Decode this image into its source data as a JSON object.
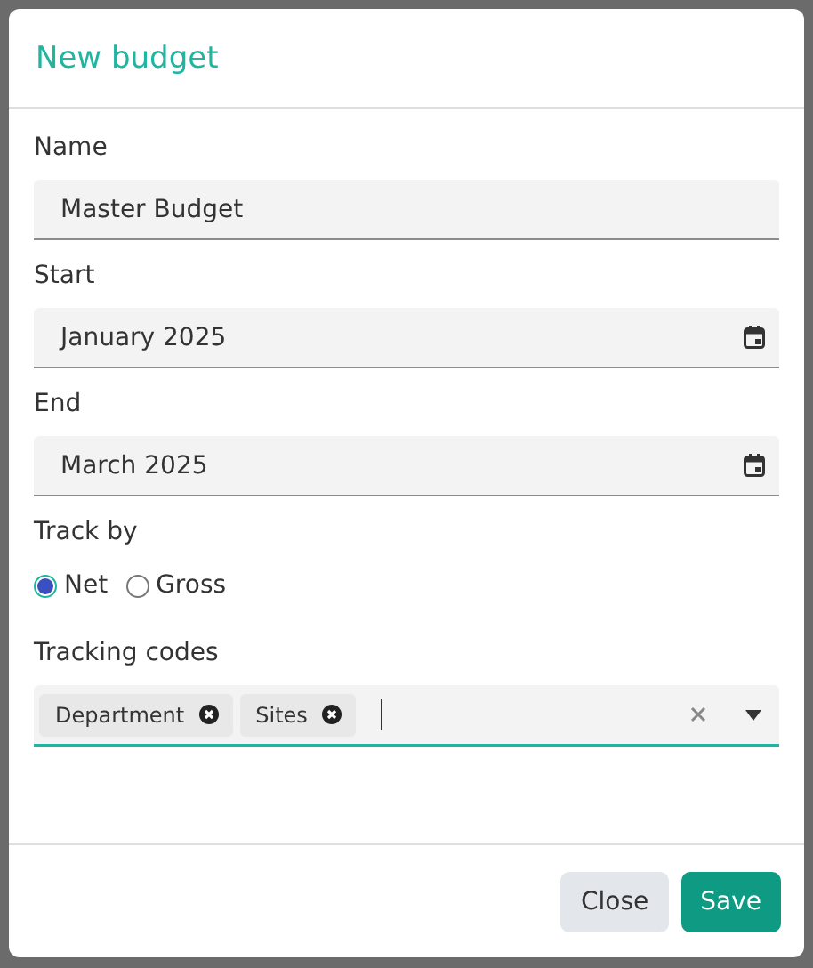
{
  "dialog": {
    "title": "New budget"
  },
  "fields": [
    {
      "kind": "text",
      "label": "Name",
      "value": "Master Budget"
    },
    {
      "kind": "date",
      "label": "Start",
      "value": "January 2025"
    },
    {
      "kind": "date",
      "label": "End",
      "value": "March 2025"
    }
  ],
  "track_by": {
    "label": "Track by",
    "options": [
      {
        "label": "Net",
        "selected": true
      },
      {
        "label": "Gross",
        "selected": false
      }
    ]
  },
  "tracking_codes": {
    "label": "Tracking codes",
    "tags": [
      "Department",
      "Sites"
    ]
  },
  "buttons": [
    {
      "kind": "secondary",
      "label": "Close"
    },
    {
      "kind": "primary",
      "label": "Save"
    }
  ]
}
